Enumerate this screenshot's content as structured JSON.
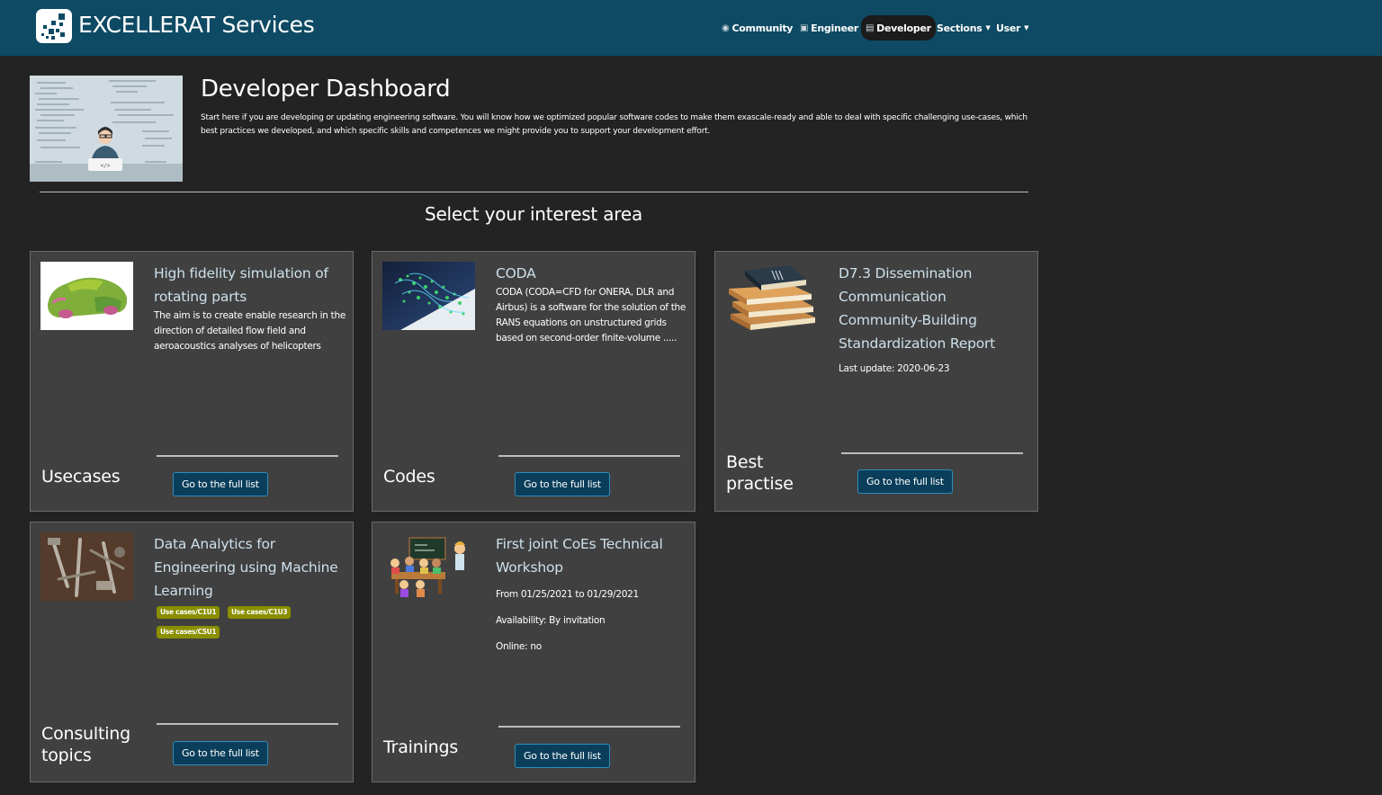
{
  "navbar": {
    "brand_title": "EXCELLERAT Services",
    "items": [
      {
        "label": "Community",
        "icon": "users-icon",
        "active": false
      },
      {
        "label": "Engineer",
        "icon": "car-icon",
        "active": false
      },
      {
        "label": "Developer",
        "icon": "list-icon",
        "active": true
      },
      {
        "label": "Sections",
        "icon": "",
        "active": false
      },
      {
        "label": "User",
        "icon": "",
        "active": false
      }
    ]
  },
  "header": {
    "title": "Developer Dashboard",
    "description": "Start here if you are developing or updating engineering software. You will know how we optimized popular software codes to make them exascale-ready and able to deal with specific challenging use-cases, which best practices we developed, and which specific skills and competences we might provide you to support your development effort."
  },
  "section_heading": "Select your interest area",
  "cards": [
    {
      "category": "Usecases",
      "title": "High fidelity simulation of rotating parts",
      "text": "The aim is to create enable research in the direction of detailed flow field and aeroacoustics analyses of helicopters",
      "button": "Go to the full list"
    },
    {
      "category": "Codes",
      "title": "CODA",
      "text": "CODA (CODA=CFD for ONERA, DLR and Airbus) is a software for the solution of the RANS equations on unstructured grids based on second-order finite-volume .....",
      "button": "Go to the full list"
    },
    {
      "category": "Best practise",
      "title": "D7.3 Dissemination Communication Community-Building Standardization Report",
      "meta": "Last update: 2020-06-23",
      "button": "Go to the full list"
    },
    {
      "category": "Consulting topics",
      "title": "Data Analytics for Engineering using Machine Learning",
      "tags": [
        "Use cases/C1U1",
        "Use cases/C1U3",
        "Use cases/C5U1"
      ],
      "button": "Go to the full list"
    },
    {
      "category": "Trainings",
      "title": "First joint CoEs Technical Workshop",
      "dates": "From 01/25/2021 to 01/29/2021",
      "availability": "Availability: By invitation",
      "online": "Online: no",
      "button": "Go to the full list"
    }
  ],
  "colors": {
    "navbar": "#0e4a63",
    "background": "#232323",
    "card": "#404040",
    "title_link": "#cde0ea",
    "button": "#0a3e5a",
    "tag": "#8a8f00"
  }
}
